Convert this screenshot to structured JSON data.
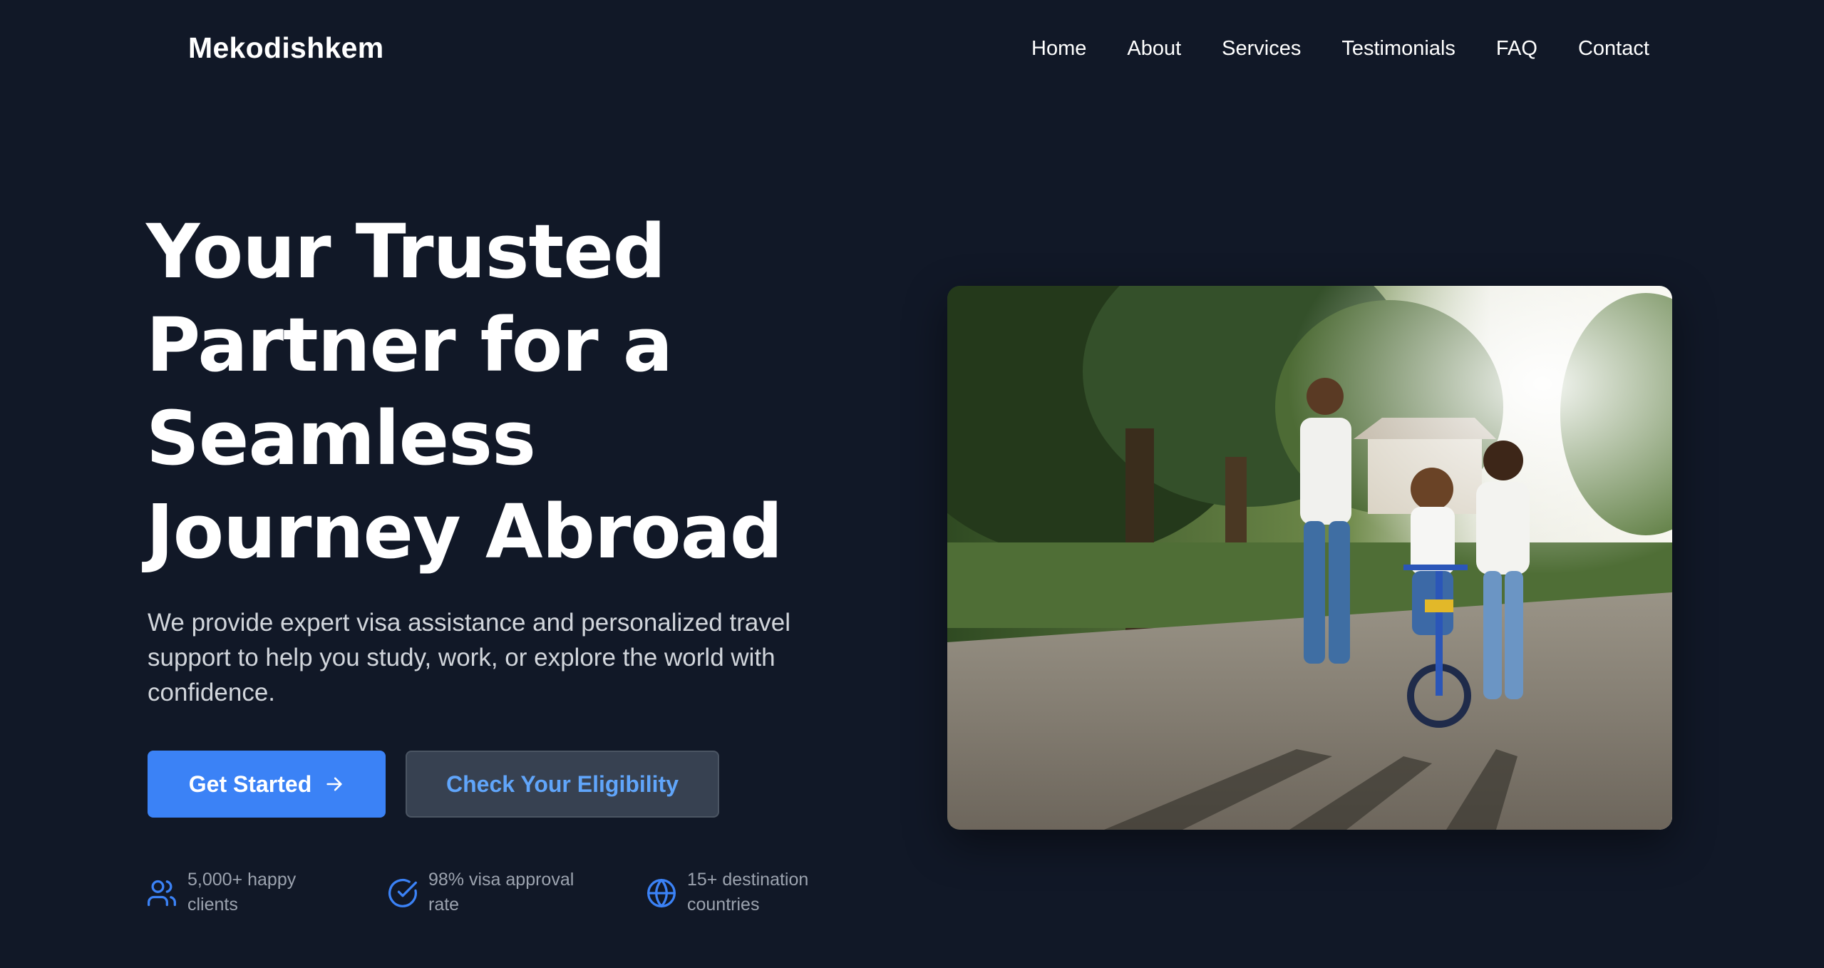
{
  "brand": "Mekodishkem",
  "nav": [
    {
      "label": "Home"
    },
    {
      "label": "About"
    },
    {
      "label": "Services"
    },
    {
      "label": "Testimonials"
    },
    {
      "label": "FAQ"
    },
    {
      "label": "Contact"
    }
  ],
  "hero": {
    "title_lines": [
      "Your Trusted",
      "Partner for a",
      "Seamless",
      "Journey Abroad"
    ],
    "subtitle": "We provide expert visa assistance and personalized travel support to help you study, work, or explore the world with confidence.",
    "primary_cta": "Get Started",
    "secondary_cta": "Check Your Eligibility"
  },
  "stats": [
    {
      "icon": "users-icon",
      "label": "5,000+ happy clients"
    },
    {
      "icon": "check-circle-icon",
      "label": "98% visa approval rate"
    },
    {
      "icon": "globe-icon",
      "label": "15+ destination countries"
    }
  ],
  "image": {
    "subject": "family-teaching-child-to-ride-bicycle-photo"
  },
  "colors": {
    "background": "#111827",
    "accent": "#3b82f6",
    "secondary_button": "#374151",
    "secondary_text": "#60a5fa",
    "icon": "#3b82f6"
  }
}
